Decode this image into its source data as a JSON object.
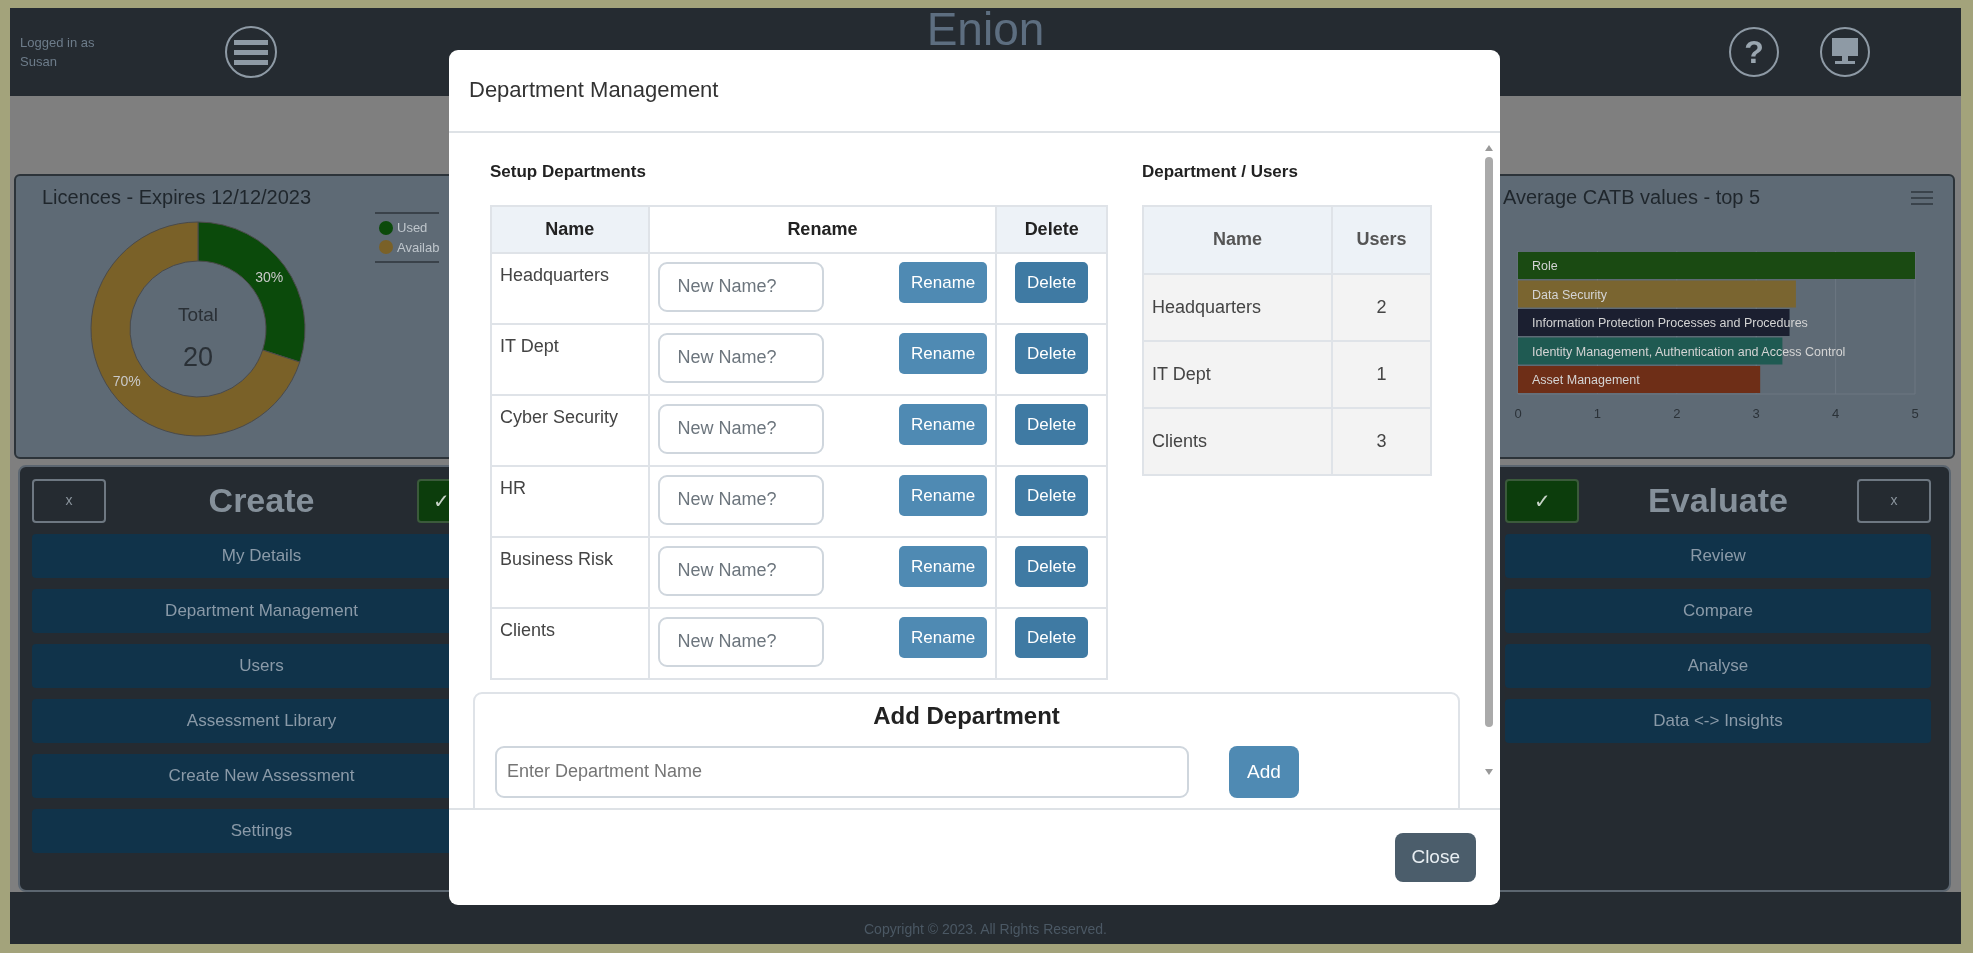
{
  "header": {
    "user_label": "Logged in as",
    "user_name": "Susan",
    "app_title": "Enion",
    "help_glyph": "?"
  },
  "licences": {
    "legend": [
      {
        "color": "#0b4a0b"
      },
      {
        "color": "#7a6128"
      }
    ],
    "center_label": "Total",
    "center_value": "20",
    "chart_data": {
      "type": "donut",
      "title": "Licences - Expires 12/12/2023",
      "categories": [
        "Used",
        "Availab"
      ],
      "values": [
        30,
        70
      ],
      "value_labels": [
        "30%",
        "70%"
      ]
    }
  },
  "catb": {
    "chart_data": {
      "type": "bar",
      "orientation": "horizontal",
      "grid": true,
      "title": "Average CATB values - top 5",
      "series": [
        {
          "name": "Role",
          "color": "#1a4a12",
          "values": [
            5,
            null,
            null,
            null,
            null
          ]
        },
        {
          "name": "Data Security",
          "color": "#7a6530",
          "values": [
            null,
            3.5,
            null,
            null,
            null
          ]
        },
        {
          "name": "Information Protection Processes and Procedures",
          "color": "#1b1f30",
          "values": [
            null,
            null,
            3.42,
            null,
            null
          ]
        },
        {
          "name": "Identity Management, Authentication and Access Control",
          "color": "#1f5a52",
          "values": [
            null,
            null,
            null,
            3.33,
            null
          ]
        },
        {
          "name": "Asset Management",
          "color": "#6e2e17",
          "values": [
            null,
            null,
            null,
            null,
            3.05
          ]
        }
      ],
      "xlim": [
        0,
        5
      ],
      "xticks": [
        0,
        1,
        2,
        3,
        4,
        5
      ]
    }
  },
  "create": {
    "close_label": "x",
    "title": "Create",
    "confirm_label": "✓",
    "items": [
      "My Details",
      "Department Management",
      "Users",
      "Assessment Library",
      "Create New Assessment",
      "Settings"
    ]
  },
  "evaluate": {
    "confirm_label": "✓",
    "title": "Evaluate",
    "close_label": "x",
    "items": [
      "Review",
      "Compare",
      "Analyse",
      "Data <-> Insights"
    ]
  },
  "footer": {
    "copyright": "Copyright © 2023. All Rights Reserved."
  },
  "modal": {
    "title": "Department Management",
    "setup": {
      "heading": "Setup Departments",
      "columns": [
        "Name",
        "Rename",
        "Delete"
      ],
      "rows": [
        {
          "name": "Headquarters",
          "placeholder": "New Name?",
          "rename_label": "Rename",
          "delete_label": "Delete"
        },
        {
          "name": "IT Dept",
          "placeholder": "New Name?",
          "rename_label": "Rename",
          "delete_label": "Delete"
        },
        {
          "name": "Cyber Security",
          "placeholder": "New Name?",
          "rename_label": "Rename",
          "delete_label": "Delete"
        },
        {
          "name": "HR",
          "placeholder": "New Name?",
          "rename_label": "Rename",
          "delete_label": "Delete"
        },
        {
          "name": "Business Risk",
          "placeholder": "New Name?",
          "rename_label": "Rename",
          "delete_label": "Delete"
        },
        {
          "name": "Clients",
          "placeholder": "New Name?",
          "rename_label": "Rename",
          "delete_label": "Delete"
        }
      ]
    },
    "users": {
      "heading": "Department / Users",
      "columns": [
        "Name",
        "Users"
      ],
      "rows": [
        {
          "name": "Headquarters",
          "users": "2"
        },
        {
          "name": "IT Dept",
          "users": "1"
        },
        {
          "name": "Clients",
          "users": "3"
        }
      ]
    },
    "add": {
      "heading": "Add Department",
      "placeholder": "Enter Department Name",
      "button": "Add"
    },
    "close": "Close"
  }
}
